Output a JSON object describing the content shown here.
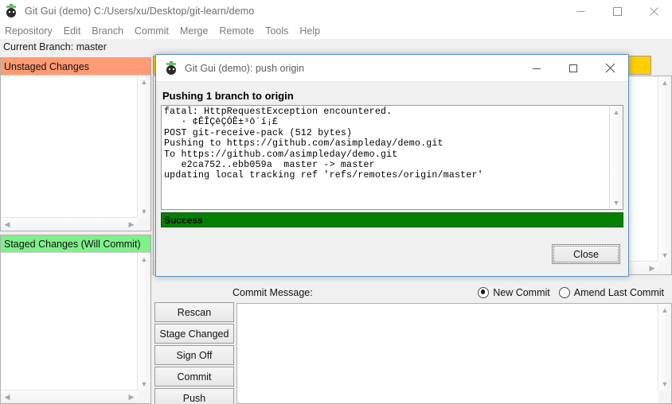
{
  "main_window": {
    "title": "Git Gui (demo) C:/Users/xu/Desktop/git-learn/demo",
    "icon": "git-gui-icon",
    "controls": {
      "minimize": "minimize-icon",
      "maximize": "maximize-icon",
      "close": "close-icon"
    },
    "menu": [
      {
        "label": "Repository"
      },
      {
        "label": "Edit"
      },
      {
        "label": "Branch"
      },
      {
        "label": "Commit"
      },
      {
        "label": "Merge"
      },
      {
        "label": "Remote"
      },
      {
        "label": "Tools"
      },
      {
        "label": "Help"
      }
    ],
    "branch_status": "Current Branch: master",
    "panels": {
      "unstaged": {
        "title": "Unstaged Changes",
        "header_color": "#ff9b72",
        "items": []
      },
      "staged": {
        "title": "Staged Changes (Will Commit)",
        "header_color": "#80f08a",
        "items": []
      }
    },
    "diff_header_color": "#ffcf00",
    "commit": {
      "message_label": "Commit Message:",
      "message_value": "",
      "mode_options": [
        {
          "label": "New Commit",
          "checked": true
        },
        {
          "label": "Amend Last Commit",
          "checked": false
        }
      ]
    },
    "buttons": [
      {
        "label": "Rescan"
      },
      {
        "label": "Stage Changed"
      },
      {
        "label": "Sign Off"
      },
      {
        "label": "Commit"
      },
      {
        "label": "Push"
      }
    ]
  },
  "dialog": {
    "title": "Git Gui (demo): push origin",
    "icon": "git-gui-icon",
    "controls": {
      "minimize": "minimize-icon",
      "maximize": "maximize-icon",
      "close": "close-icon"
    },
    "heading": "Pushing 1 branch to origin",
    "console_output": "fatal: HttpRequestException encountered.\n   · ¢ĒÎÇēÇÓÊ±³ō´í¡£\nPOST git-receive-pack (512 bytes)\nPushing to https://github.com/asimpleday/demo.git\nTo https://github.com/asimpleday/demo.git\n   e2ca752..ebb059a  master -> master\nupdating local tracking ref 'refs/remotes/origin/master'",
    "status": {
      "text": "Success",
      "color": "#068003"
    },
    "close_label": "Close"
  }
}
